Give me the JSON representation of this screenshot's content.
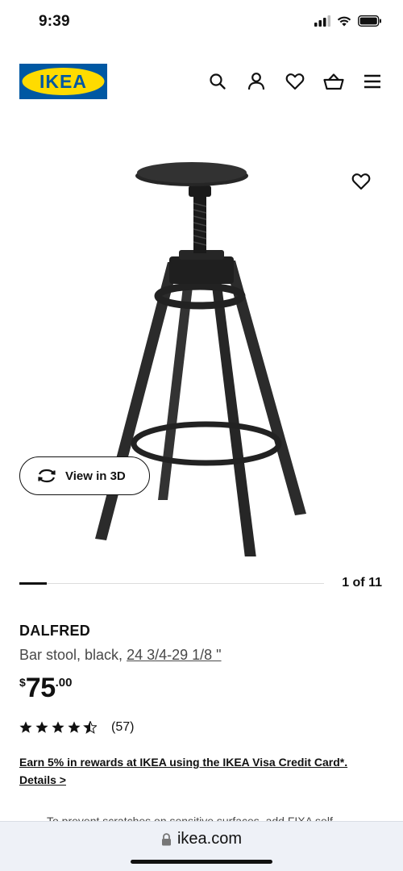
{
  "status": {
    "time": "9:39"
  },
  "brand": {
    "logo_text": "IKEA",
    "blue": "#0058A3",
    "yellow": "#FFDB00"
  },
  "header": {
    "icons": [
      "search-icon",
      "account-icon",
      "heart-icon",
      "basket-icon",
      "menu-icon"
    ]
  },
  "gallery": {
    "view3d_label": "View in 3D",
    "pager_text": "1 of 11",
    "progress": 0.09
  },
  "product": {
    "name": "DALFRED",
    "description": "Bar stool, black, ",
    "size": "24 3/4-29 1/8 \"",
    "price": {
      "currency": "$",
      "integer": "75",
      "decimals": ".00"
    },
    "rating": {
      "stars": 4.5,
      "count": "(57)"
    }
  },
  "promo": {
    "text": "Earn 5% in rewards at IKEA using the IKEA Visa Credit Card*.",
    "link": "Details >"
  },
  "cut_text": "To prevent scratches on sensitive surfaces, add FIXA self-",
  "browser": {
    "url": "ikea.com"
  }
}
